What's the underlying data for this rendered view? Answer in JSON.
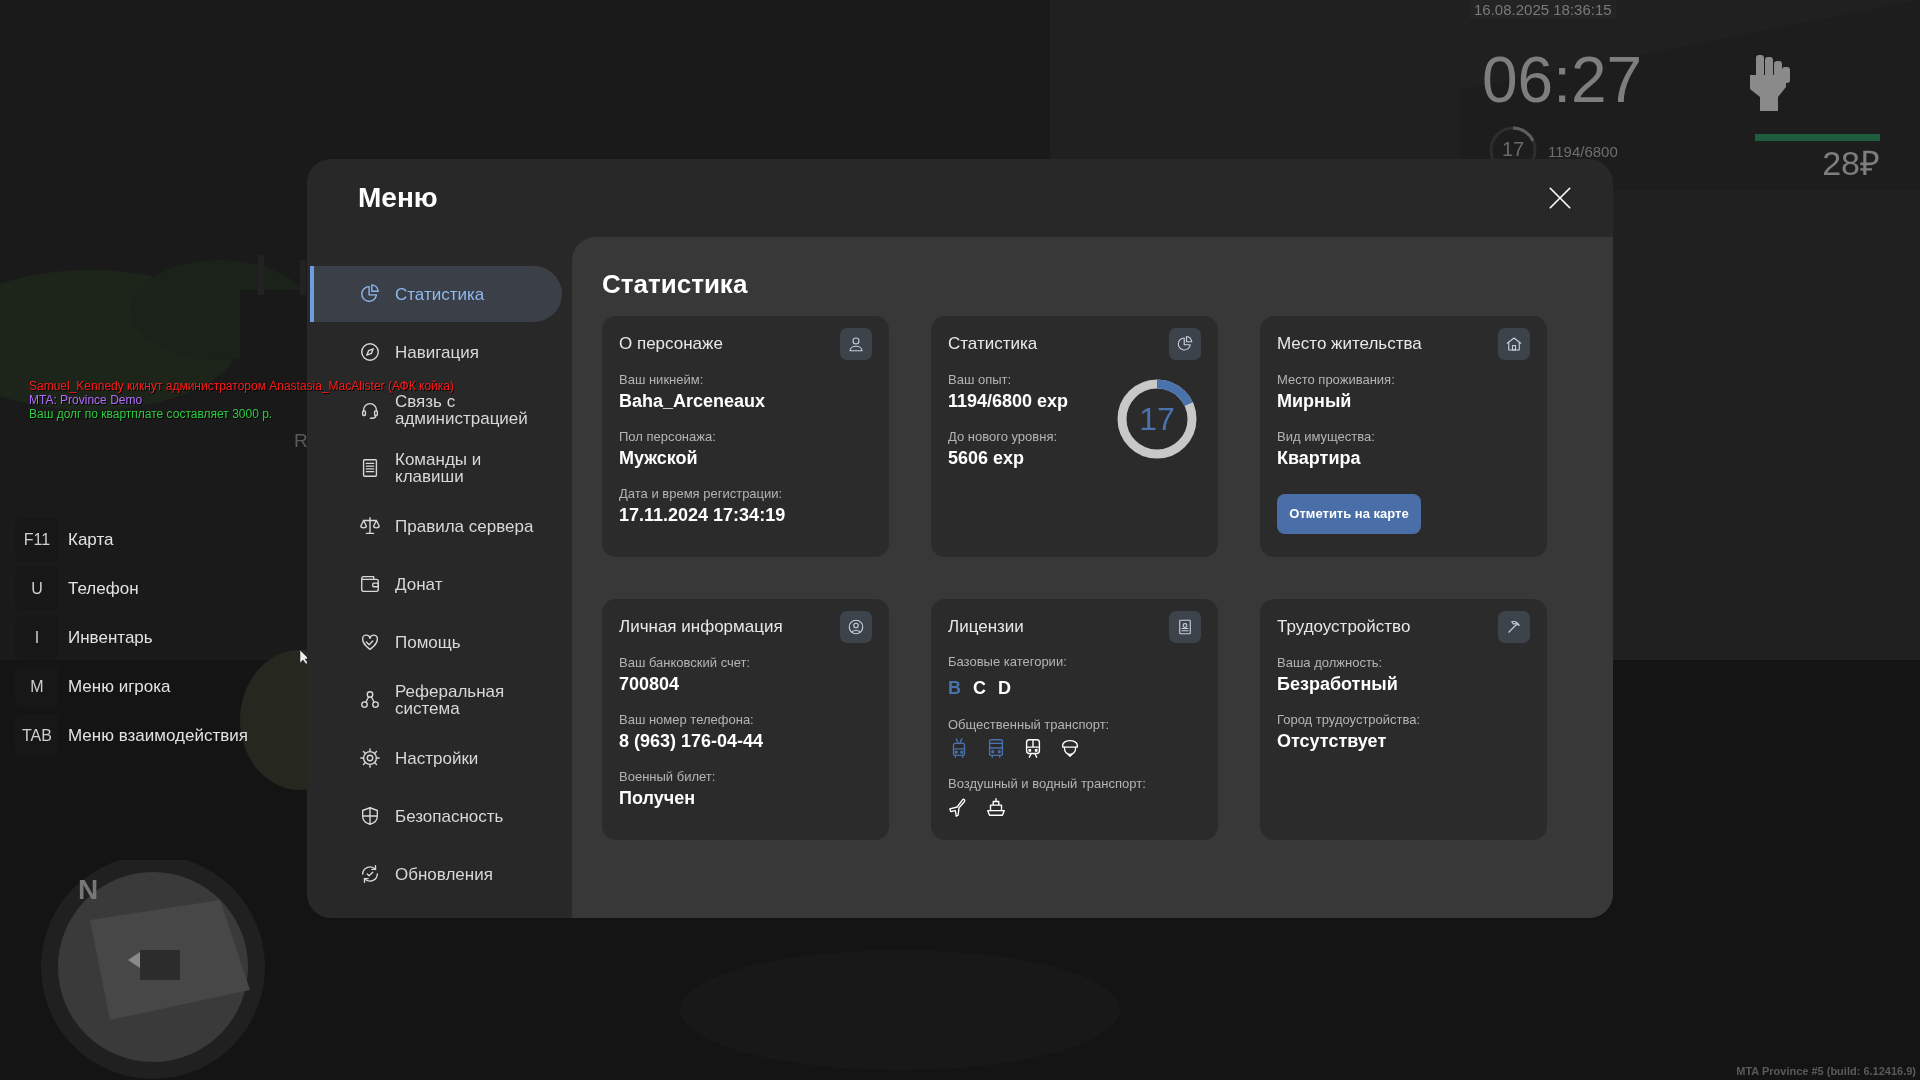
{
  "hud": {
    "datetime": "16.08.2025 18:36:15",
    "clock": "06:27",
    "level_ring": {
      "value": "17",
      "level": 0.18
    },
    "experience": "1194/6800",
    "status_bar": {
      "level": 1
    },
    "money": "28₽"
  },
  "chat": [
    {
      "text": "Samuel_Kennedy кикнут администратором Anastasia_MacAlister (АФК койка)",
      "color": "#ff1a1a"
    },
    {
      "text": "MTA: Province Demo",
      "color": "#b36bff"
    },
    {
      "text": "Ваш долг по квартплате составляет 3000 р.",
      "color": "#2ecc40"
    }
  ],
  "background_letter": "R",
  "hotkeys": [
    {
      "key": "F11",
      "label": "Карта"
    },
    {
      "key": "U",
      "label": "Телефон"
    },
    {
      "key": "I",
      "label": "Инвентарь"
    },
    {
      "key": "M",
      "label": "Меню игрока"
    },
    {
      "key": "TAB",
      "label": "Меню взаимодействия"
    }
  ],
  "minimap": {
    "north": "N"
  },
  "menu": {
    "title": "Меню",
    "sidebar": [
      {
        "label": "Статистика",
        "selected": true
      },
      {
        "label": "Навигация",
        "selected": false
      },
      {
        "label": "Связь с\nадминистрацией",
        "selected": false
      },
      {
        "label": "Команды и\nклавиши",
        "selected": false
      },
      {
        "label": "Правила сервера",
        "selected": false
      },
      {
        "label": "Донат",
        "selected": false
      },
      {
        "label": "Помощь",
        "selected": false
      },
      {
        "label": "Реферальная\nсистема",
        "selected": false
      },
      {
        "label": "Настройки",
        "selected": false
      },
      {
        "label": "Безопасность",
        "selected": false
      },
      {
        "label": "Обновления",
        "selected": false
      }
    ],
    "content": {
      "title": "Статистика",
      "cards": [
        {
          "kind": "info",
          "title": "О персонаже",
          "fields": [
            {
              "label": "Ваш никнейм:",
              "value": "Baha_Arceneaux"
            },
            {
              "label": "Пол персонажа:",
              "value": "Мужской"
            },
            {
              "label": "Дата и время регистрации:",
              "value": "17.11.2024 17:34:19"
            }
          ]
        },
        {
          "kind": "stats",
          "title": "Статистика",
          "fields": [
            {
              "label": "Ваш опыт:",
              "value": "1194/6800 exp"
            },
            {
              "label": "До нового уровня:",
              "value": "5606 exp"
            }
          ],
          "ring": {
            "value": "17",
            "level": 0.18
          }
        },
        {
          "kind": "info",
          "title": "Место жительства",
          "fields": [
            {
              "label": "Место проживания:",
              "value": "Мирный"
            },
            {
              "label": "Вид имущества:",
              "value": "Квартира"
            }
          ],
          "button": "Отметить на карте"
        },
        {
          "kind": "info",
          "title": "Личная информация",
          "fields": [
            {
              "label": "Ваш банковский счет:",
              "value": "700804"
            },
            {
              "label": "Ваш номер телефона:",
              "value": "8 (963) 176-04-44"
            },
            {
              "label": "Военный билет:",
              "value": "Получен"
            }
          ]
        },
        {
          "kind": "licenses",
          "title": "Лицензии",
          "sections": [
            {
              "kind": "categories",
              "label": "Базовые категории:",
              "items": [
                {
                  "text": "B",
                  "owned": true
                },
                {
                  "text": "C",
                  "owned": false
                },
                {
                  "text": "D",
                  "owned": false
                }
              ]
            },
            {
              "kind": "transport",
              "label": "Общественный транспорт:",
              "items": [
                {
                  "owned": true
                },
                {
                  "owned": true
                },
                {
                  "owned": false
                },
                {
                  "owned": false
                }
              ]
            },
            {
              "kind": "transport",
              "label": "Воздушный и водный транспорт:",
              "items": [
                {
                  "owned": false
                },
                {
                  "owned": false
                }
              ]
            }
          ]
        },
        {
          "kind": "info",
          "title": "Трудоустройство",
          "fields": [
            {
              "label": "Ваша должность:",
              "value": "Безработный"
            },
            {
              "label": "Город трудоустройства:",
              "value": "Отсутствует"
            }
          ]
        }
      ]
    }
  },
  "build": "MTA Province #5 (build: 6.12416.9)"
}
